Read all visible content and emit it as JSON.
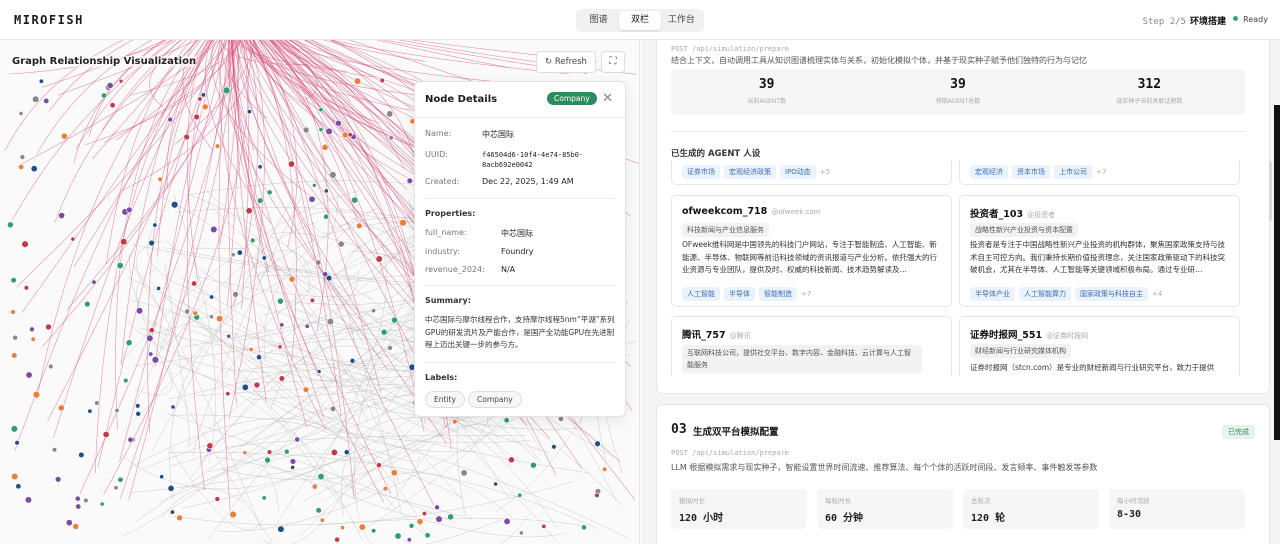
{
  "header": {
    "brand": "MIROFISH",
    "tabs": [
      {
        "label": "图谱",
        "active": false
      },
      {
        "label": "双栏",
        "active": true
      },
      {
        "label": "工作台",
        "active": false
      }
    ],
    "step_label": "Step 2/5",
    "step_name": "环境搭建",
    "status": "Ready",
    "status_color": "#2eaa6a"
  },
  "graph": {
    "title": "Graph Relationship Visualization",
    "refresh_label": "Refresh",
    "refresh_icon": "refresh-icon",
    "fullscreen_icon": "fullscreen-icon",
    "edge_color": "#d63a6a",
    "node_colors": [
      "#1f4e8c",
      "#f07c3a",
      "#2f9e6e",
      "#7a4aa8",
      "#c23a4a",
      "#888888"
    ]
  },
  "node_details": {
    "title": "Node Details",
    "badge": "Company",
    "badge_color": "#2c8c5c",
    "name_label": "Name:",
    "name": "中芯国际",
    "uuid_label": "UUID:",
    "uuid": "f46504d6-10f4-4e74-85b0-8acb692e0042",
    "created_label": "Created:",
    "created": "Dec 22, 2025, 1:49 AM",
    "properties_label": "Properties:",
    "properties": [
      {
        "key": "full_name:",
        "value": "中芯国际"
      },
      {
        "key": "industry:",
        "value": "Foundry"
      },
      {
        "key": "revenue_2024:",
        "value": "N/A"
      }
    ],
    "summary_label": "Summary:",
    "summary": "中芯国际与摩尔线程合作，支持摩尔线程5nm“平湖”系列GPU的研发流片及产能合作，是国产全功能GPU在先进制程上迈出关键一步的参与方。",
    "labels_label": "Labels:",
    "labels": [
      "Entity",
      "Company"
    ]
  },
  "card1": {
    "api": "POST /api/simulation/prepare",
    "desc": "结合上下文，自动调用工具从知识图谱梳理实体与关系，初始化模拟个体，并基于现实种子赋予他们独特的行为与记忆",
    "stats": [
      {
        "value": "39",
        "label": "当前AGENT数"
      },
      {
        "value": "39",
        "label": "预期AGENT总数"
      },
      {
        "value": "312",
        "label": "现实种子当前关联话题数"
      }
    ],
    "agents_title": "已生成的 AGENT 人设",
    "agents": [
      {
        "name": "",
        "handle": "",
        "role": "",
        "bio": "",
        "tags": [
          "证券市场",
          "宏观经济政策",
          "IPO动态"
        ],
        "more": "+5"
      },
      {
        "name": "",
        "handle": "",
        "role": "",
        "bio": "",
        "tags": [
          "宏观经济",
          "资本市场",
          "上市公司"
        ],
        "more": "+7"
      },
      {
        "name": "ofweekcom_718",
        "handle": "@ofweek.com",
        "role": "科技新闻与产业信息服务",
        "bio": "OFweek维科网是中国领先的科技门户网站，专注于智能制造、人工智能、新能源、半导体、物联网等前沿科技领域的资讯报道与产业分析。依托强大的行业资源与专业团队，提供及时、权威的科技新闻、技术趋势解读及…",
        "tags": [
          "人工智能",
          "半导体",
          "智能制造"
        ],
        "more": "+7"
      },
      {
        "name": "投资者_103",
        "handle": "@投资者",
        "role": "战略性新兴产业投资与资本配置",
        "bio": "投资者是专注于中国战略性新兴产业投资的机构群体，聚焦国家政策支持与技术自主可控方向。我们秉持长期价值投资理念，关注国家政策驱动下的科技突破机会，尤其在半导体、人工智能等关键领域积极布局。通过专业研…",
        "tags": [
          "半导体产业",
          "人工智能算力",
          "国家政策与科技自主"
        ],
        "more": "+4"
      },
      {
        "name": "腾讯_757",
        "handle": "@腾讯",
        "role": "互联网科技公司，提供社交平台、数字内容、金融科技、云计算与人工智能服务",
        "bio": "",
        "tags": [],
        "more": ""
      },
      {
        "name": "证券时报网_551",
        "handle": "@证券时报网",
        "role": "财经新闻与行业研究媒体机构",
        "bio": "证券时报网（stcn.com）是专业的财经新闻与行业研究平台，致力于提供",
        "tags": [],
        "more": ""
      }
    ]
  },
  "card3": {
    "num": "03",
    "title": "生成双平台模拟配置",
    "status": "已完成",
    "api": "POST /api/simulation/prepare",
    "desc": "LLM 根据模拟需求与现实种子，智能设置世界时间流速、推荐算法、每个个体的活跃时间段、发言频率、事件触发等参数",
    "configs": [
      {
        "label": "模拟时长",
        "value": "120 小时"
      },
      {
        "label": "每轮时长",
        "value": "60 分钟"
      },
      {
        "label": "总轮次",
        "value": "120 轮"
      },
      {
        "label": "每小时活跃",
        "value": "8-30"
      }
    ]
  }
}
